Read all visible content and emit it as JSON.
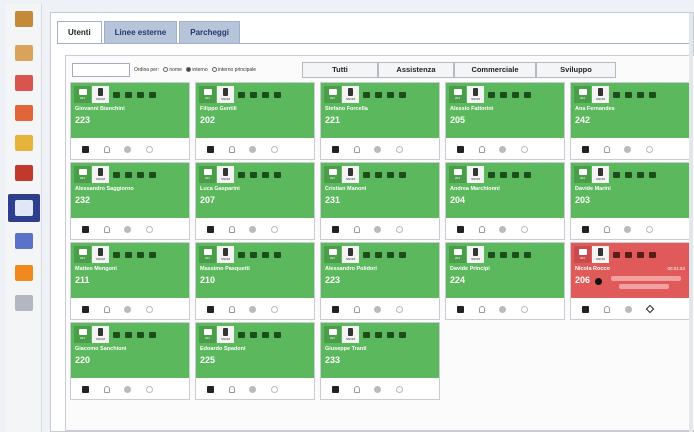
{
  "sidebar": {
    "items": [
      {
        "name": "contacts-book-icon",
        "color": "#c48a3a"
      },
      {
        "name": "user-config-icon",
        "color": "#d9a45a"
      },
      {
        "name": "phone-blocked-icon",
        "color": "#d9534f"
      },
      {
        "name": "calendar-icon",
        "color": "#e0663a"
      },
      {
        "name": "user-gold-icon",
        "color": "#e6b43c"
      },
      {
        "name": "inbox-icon",
        "color": "#c0392b"
      },
      {
        "name": "monitor-panel-icon",
        "color": "#dfe6f5",
        "active": true
      },
      {
        "name": "network-icon",
        "color": "#5a72c8"
      },
      {
        "name": "clock-icon",
        "color": "#f08a1c"
      },
      {
        "name": "printer-icon",
        "color": "#b3b7bf"
      }
    ]
  },
  "tabs": [
    {
      "label": "Utenti",
      "active": true
    },
    {
      "label": "Linee esterne",
      "active": false
    },
    {
      "label": "Parcheggi",
      "active": false
    }
  ],
  "filter": {
    "search_value": "",
    "order_label": "Ordina per:",
    "options": [
      {
        "label": "nome",
        "selected": false
      },
      {
        "label": "interno",
        "selected": true
      },
      {
        "label": "interno principale",
        "selected": false
      }
    ],
    "groups": [
      "Tutti",
      "Assistenza",
      "Commerciale",
      "Sviluppo"
    ]
  },
  "card_icons": {
    "phone_sub": "SNOM",
    "ext_sub": "201"
  },
  "cards": [
    {
      "name": "Giovanni Bianchini",
      "ext": "223",
      "status": "free",
      "phone_sub": "SNOM"
    },
    {
      "name": "Filippo Gentili",
      "ext": "202",
      "status": "free",
      "phone_sub": "SNOM"
    },
    {
      "name": "Stefano Forcella",
      "ext": "221",
      "status": "free",
      "phone_sub": "SNOM"
    },
    {
      "name": "Alessio Fattorini",
      "ext": "205",
      "status": "free",
      "phone_sub": "SNOM"
    },
    {
      "name": "Ana Fernandes",
      "ext": "242",
      "status": "free",
      "phone_sub": "SNOM"
    },
    {
      "name": "Alessandro Saggiorno",
      "ext": "232",
      "status": "free",
      "phone_sub": "SNOM"
    },
    {
      "name": "Luca Gasparini",
      "ext": "207",
      "status": "free",
      "phone_sub": "SNOM"
    },
    {
      "name": "Cristian Manoni",
      "ext": "231",
      "status": "free",
      "phone_sub": "SNOM"
    },
    {
      "name": "Andrea Marchionni",
      "ext": "204",
      "status": "free",
      "phone_sub": "SNOM"
    },
    {
      "name": "Davide Marini",
      "ext": "203",
      "status": "free",
      "phone_sub": "SNOM"
    },
    {
      "name": "Matteo Mengoni",
      "ext": "211",
      "status": "free",
      "phone_sub": "SNOM"
    },
    {
      "name": "Massimo Pasquetti",
      "ext": "210",
      "status": "free",
      "phone_sub": "SNOM"
    },
    {
      "name": "Alessandro Polidori",
      "ext": "223",
      "status": "free",
      "phone_sub": "SNOM"
    },
    {
      "name": "Davide Principi",
      "ext": "224",
      "status": "free",
      "phone_sub": "SNOM"
    },
    {
      "name": "Nicola Rocco",
      "ext": "206",
      "status": "busy",
      "phone_sub": "SNOM",
      "time": "00:01:53"
    },
    {
      "name": "Giacomo Sanchioni",
      "ext": "220",
      "status": "free",
      "phone_sub": "SNOM"
    },
    {
      "name": "Edoardo Spadoni",
      "ext": "225",
      "status": "free",
      "phone_sub": "SNOM"
    },
    {
      "name": "Giuseppe Tranti",
      "ext": "233",
      "status": "free",
      "phone_sub": "SNOM"
    }
  ],
  "colors": {
    "free": "#5cb85c",
    "busy": "#e05a5a",
    "accent": "#2c3e8c"
  }
}
